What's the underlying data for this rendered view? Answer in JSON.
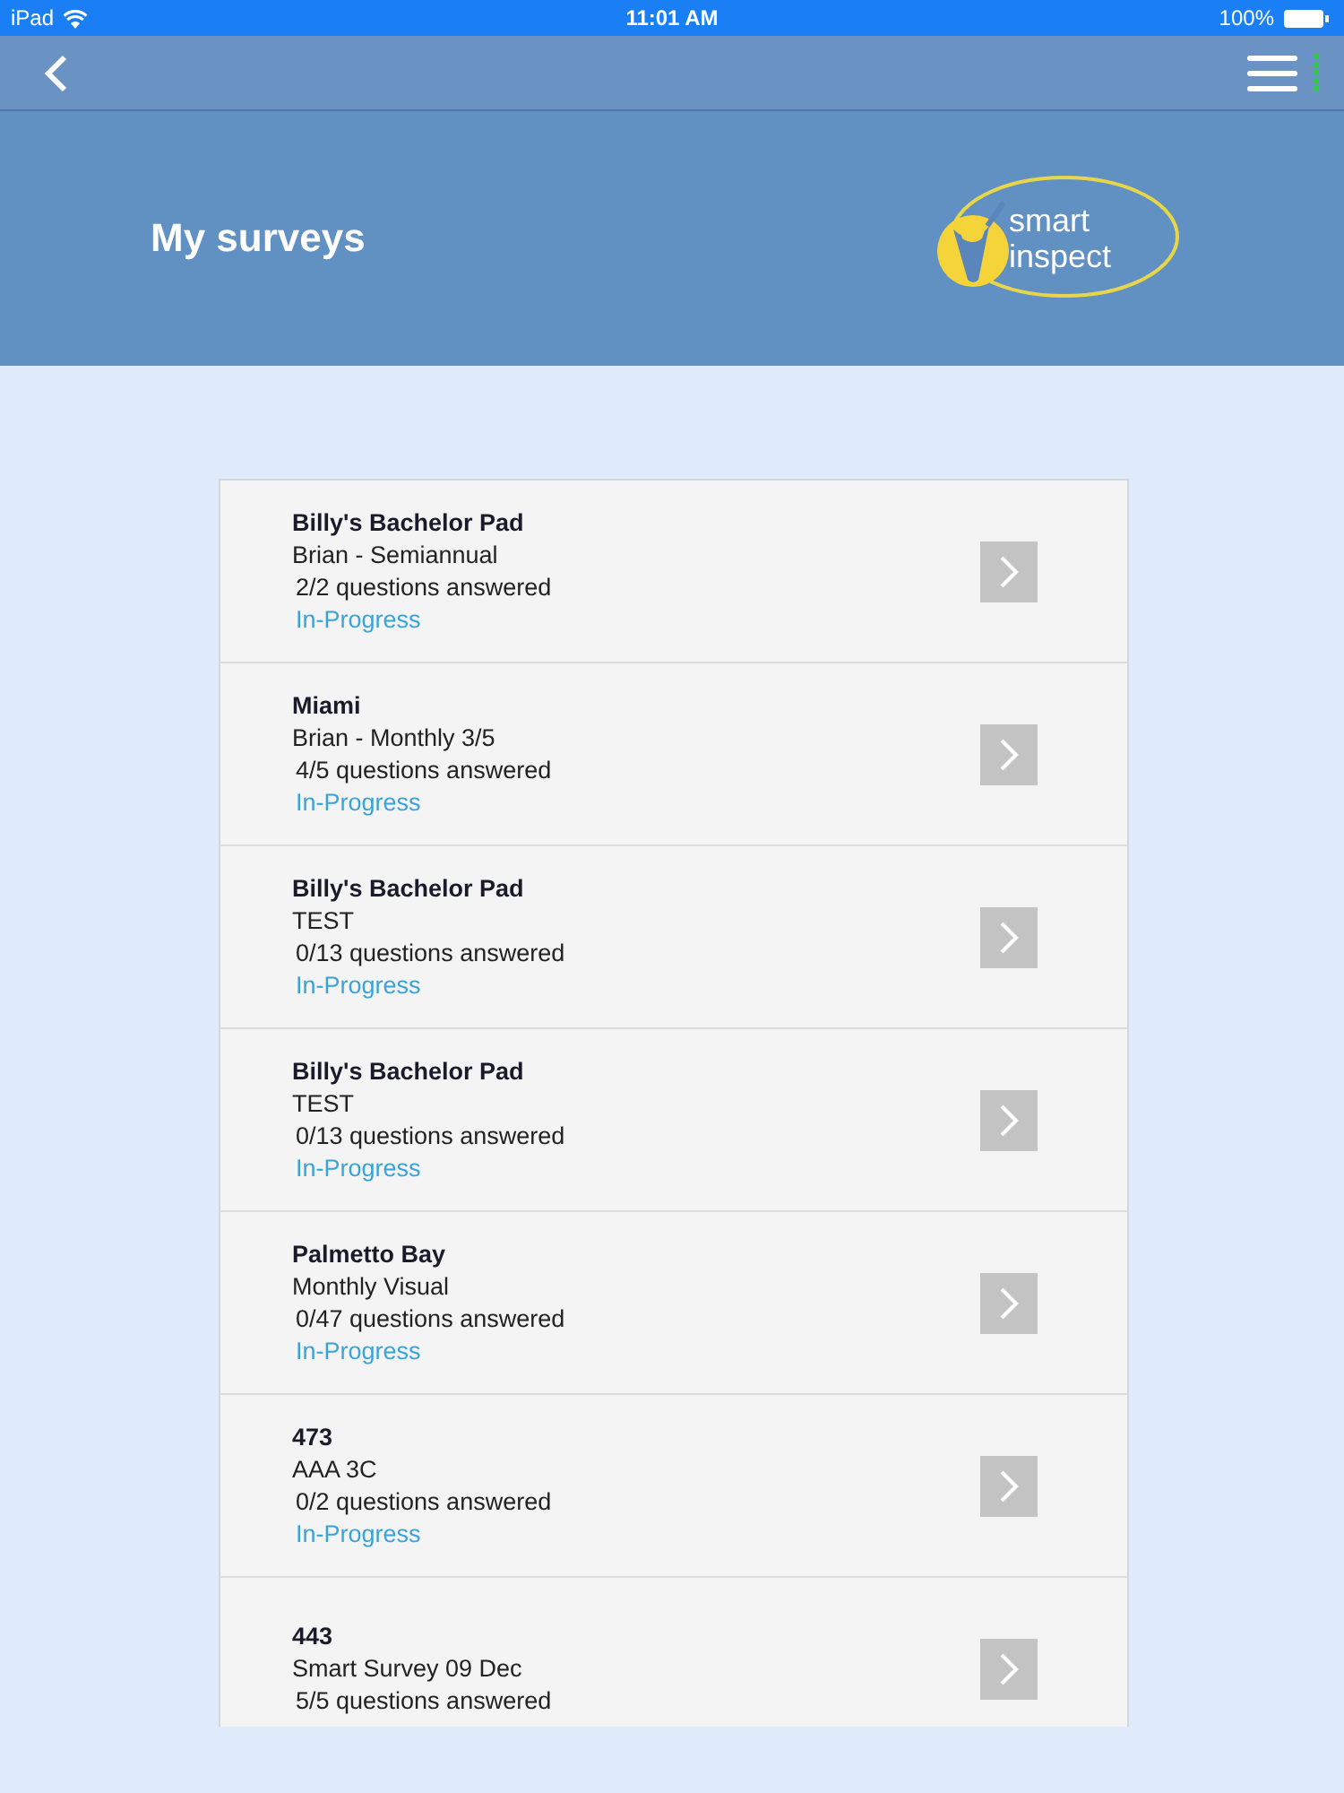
{
  "status_bar": {
    "carrier": "iPad",
    "time": "11:01 AM",
    "battery": "100%"
  },
  "header": {
    "title": "My surveys",
    "logo": {
      "line_1": "smart",
      "line_2": "inspect"
    }
  },
  "surveys": [
    {
      "title": "Billy's Bachelor Pad",
      "subtitle": "Brian - Semiannual",
      "progress": "2/2 questions answered",
      "status": "In-Progress"
    },
    {
      "title": "Miami",
      "subtitle": "Brian - Monthly 3/5",
      "progress": "4/5 questions answered",
      "status": "In-Progress"
    },
    {
      "title": "Billy's Bachelor Pad",
      "subtitle": "TEST",
      "progress": "0/13 questions answered",
      "status": "In-Progress"
    },
    {
      "title": "Billy's Bachelor Pad",
      "subtitle": "TEST",
      "progress": "0/13 questions answered",
      "status": "In-Progress"
    },
    {
      "title": "Palmetto Bay",
      "subtitle": "Monthly Visual",
      "progress": "0/47 questions answered",
      "status": "In-Progress"
    },
    {
      "title": "473",
      "subtitle": "AAA 3C",
      "progress": "0/2 questions answered",
      "status": "In-Progress"
    },
    {
      "title": "443",
      "subtitle": "Smart Survey 09 Dec",
      "progress": "5/5 questions answered"
    }
  ]
}
